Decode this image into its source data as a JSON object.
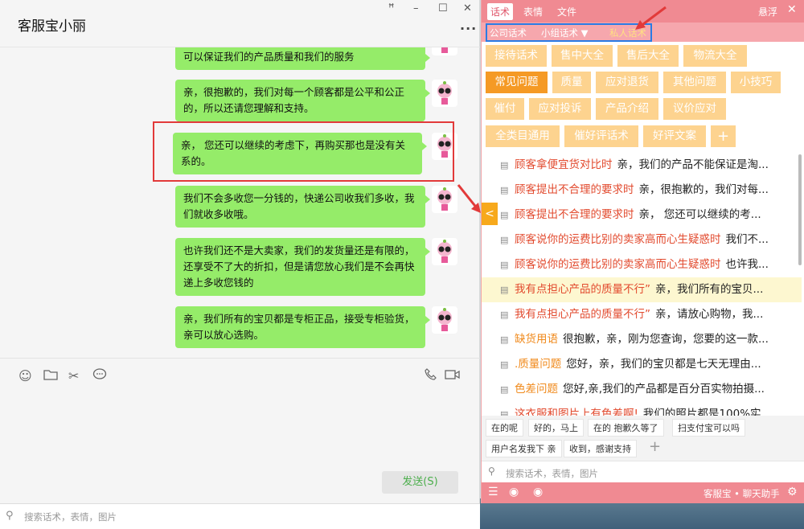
{
  "chat": {
    "title": "客服宝小丽",
    "pin": "ꟸ",
    "min": "–",
    "max": "☐",
    "close": "✕",
    "more": "···",
    "messages": [
      "可以保证我们的产品质量和我们的服务",
      "亲，很抱歉的，我们对每一个顾客都是公平和公正的，所以还请您理解和支持。",
      "亲， 您还可以继续的考虑下，再购买那也是没有关系的。",
      "我们不会多收您一分钱的，快递公司收我们多收，我们就收多收哦。",
      "也许我们还不是大卖家，我们的发货量还是有限的，还享受不了大的折扣，但是请您放心我们是不会再快递上多收您钱的",
      "亲，我们所有的宝贝都是专柜正品，接受专柜验货，亲可以放心选购。"
    ],
    "send": "发送(S)",
    "search_placeholder": "搜索话术，表情，图片"
  },
  "panel": {
    "tabs": [
      "话术",
      "表情",
      "文件"
    ],
    "float": "悬浮",
    "close": "✕",
    "subtabs": [
      "公司话术",
      "小组话术 ▼",
      "私人话术"
    ],
    "categories": [
      "接待话术",
      "售中大全",
      "售后大全",
      "物流大全",
      "常见问题",
      "质量",
      "应对退货",
      "其他问题",
      "小技巧",
      "催付",
      "应对投诉",
      "产品介绍",
      "议价应对",
      "全类目通用",
      "催好评话术",
      "好评文案",
      "+"
    ],
    "rows": [
      {
        "t": "顾客拿便宜货对比时",
        "c": "亲，我们的产品不能保证是淘..."
      },
      {
        "t": "顾客提出不合理的要求时",
        "c": "亲，很抱歉的，我们对每..."
      },
      {
        "t": "顾客提出不合理的要求时",
        "c": "亲， 您还可以继续的考..."
      },
      {
        "t": "顾客说你的运费比别的卖家高而心生疑惑时",
        "c": "我们不..."
      },
      {
        "t": "顾客说你的运费比别的卖家高而心生疑惑时",
        "c": "也许我..."
      },
      {
        "t": "我有点担心产品的质量不行”",
        "c": "亲，我们所有的宝贝..."
      },
      {
        "t": "我有点担心产品的质量不行”",
        "c": "亲，请放心购物，我..."
      },
      {
        "t": "缺货用语",
        "c": "很抱歉，亲，刚为您查询，您要的这一款..."
      },
      {
        "t": ".质量问题",
        "c": "您好，亲，我们的宝贝都是七天无理由..."
      },
      {
        "t": "色差问题",
        "c": "您好,亲,我们的产品都是百分百实物拍摄..."
      },
      {
        "t": "这衣服和图片上有色差啊!",
        "c": "我们的照片都是100%实..."
      }
    ],
    "quick": [
      "在的呢",
      "好的，马上",
      "在的 抱歉久等了",
      "扫支付宝可以吗",
      "用户名发我下 亲",
      "收到，感谢支持",
      "+"
    ],
    "search_placeholder": "搜索话术，表情，图片",
    "brand": "客服宝 • 聊天助手"
  }
}
